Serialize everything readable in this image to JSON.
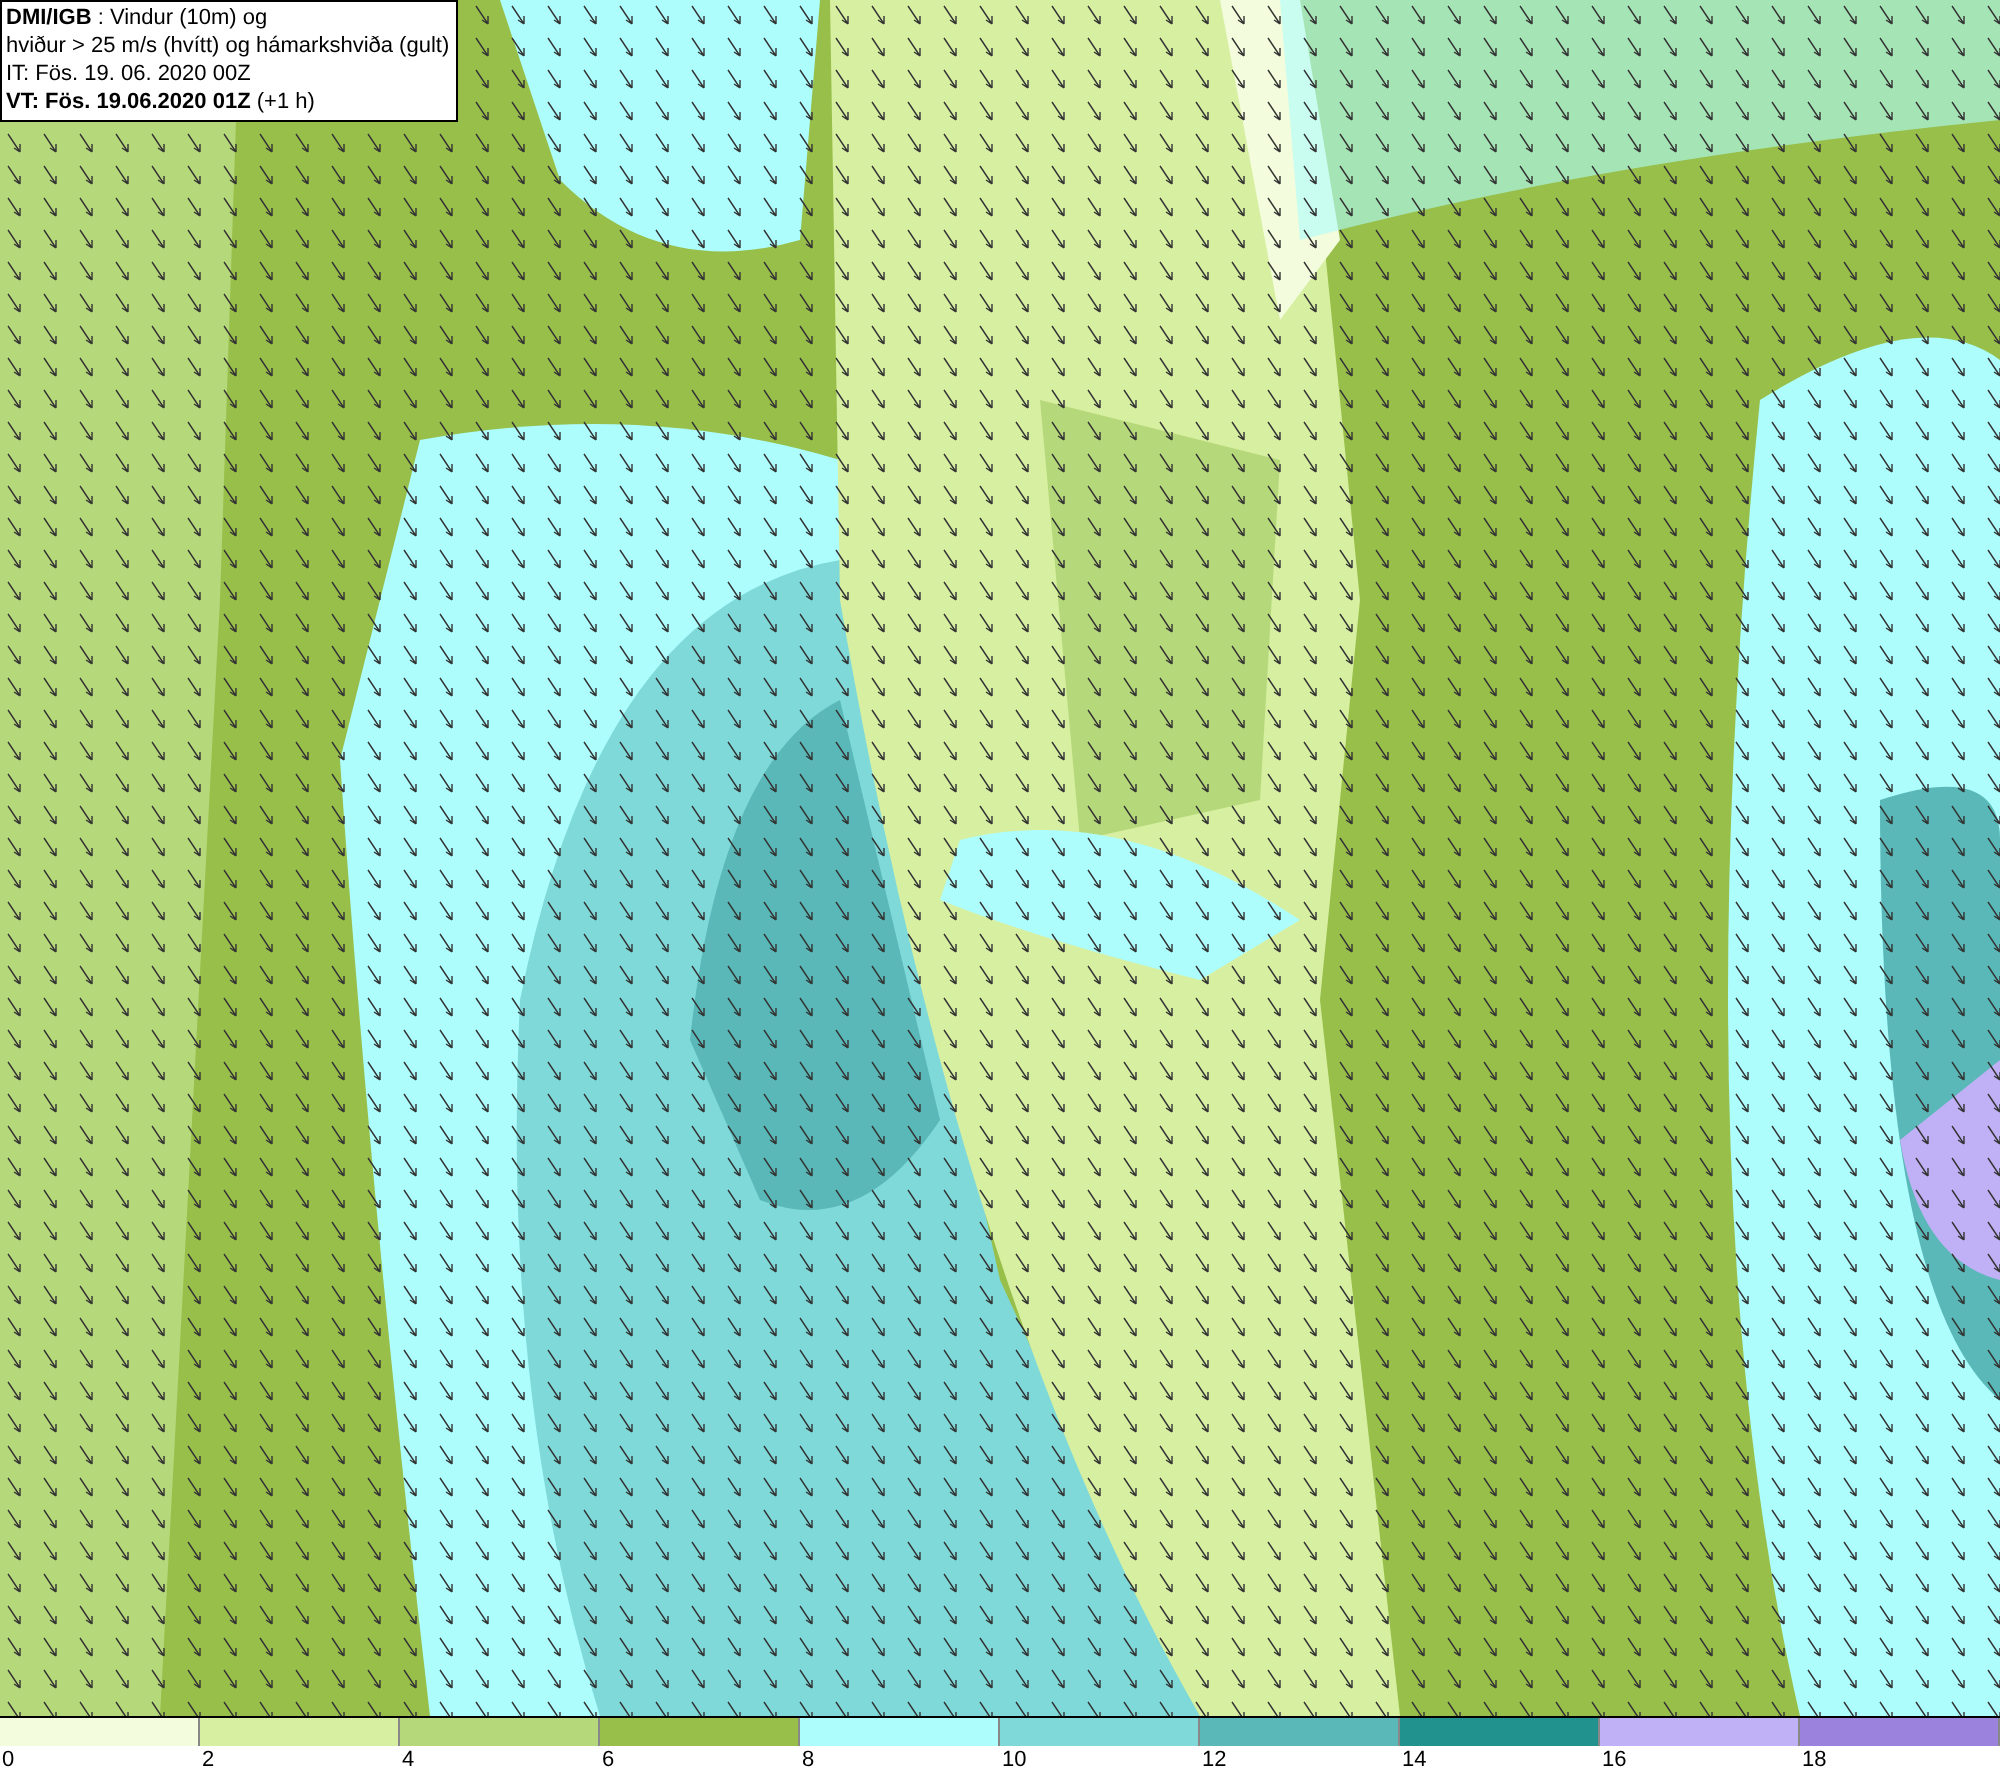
{
  "info_box": {
    "lines": [
      "**DMI/IGB** : Vindur (10m) og",
      "hviður > 25 m/s (hvítt) og hámarkshviða (gult)",
      "IT: Fös. 19. 06. 2020 00Z",
      "**VT: Fös. 19.06.2020 01Z** (+1 h)"
    ]
  },
  "legend": {
    "bins": [
      {
        "label": "0",
        "color": "#f3fcdc"
      },
      {
        "label": "2",
        "color": "#d7efa0"
      },
      {
        "label": "4",
        "color": "#b5d97a"
      },
      {
        "label": "6",
        "color": "#98bf4a"
      },
      {
        "label": "8",
        "color": "#adfdfd"
      },
      {
        "label": "10",
        "color": "#7fd9d9"
      },
      {
        "label": "12",
        "color": "#5ab8b8"
      },
      {
        "label": "14",
        "color": "#22928e"
      },
      {
        "label": "16",
        "color": "#c0b0f5"
      },
      {
        "label": "18",
        "color": "#9b82dd"
      }
    ]
  }
}
